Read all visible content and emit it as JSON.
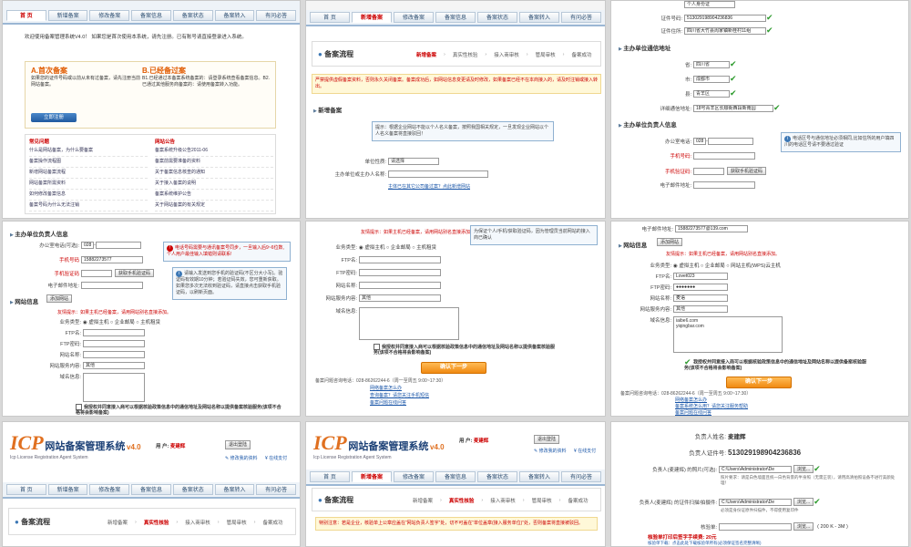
{
  "tabs": [
    "首 页",
    "新增备案",
    "修改备案",
    "备案信息",
    "备案状态",
    "备案转入",
    "有问必答"
  ],
  "p1": {
    "intro": "欢迎使用备案管理系统V4.0！ 如果您是首次使用本系统，请先注册。已有账号请直接登录进入系统。",
    "firstA": "A.首次备案",
    "firstA_text": "如果您的证件号码或以前从未有过备案，请先注册当前网站备案。",
    "firstB": "B.已经备过案",
    "firstB_text": "B1.已经通过本备案系统备案的：请登录系统查看备案信息。B2.已通过其他服务商备案的：请使用备案转入功能。",
    "register_btn": "立即注册",
    "faq_title": "常见问题",
    "notice_title": "网站公告",
    "faq": [
      "什么是网站备案，为什么要备案",
      "备案操作流程图",
      "新增网站备案流程",
      "网站备案所需资料",
      "如何修改备案信息",
      "备案号码为什么无法注销"
    ],
    "notice": [
      "备案系统升级公告2011-06",
      "备案前需要准备的资料",
      "关于备案信息核查的通知",
      "关于接入备案的说明",
      "备案系统维护公告",
      "关于网站备案的有关规定"
    ]
  },
  "p2": {
    "section": "备案流程",
    "flow": [
      "新增备案",
      "真实性核验",
      "接入商审核",
      "管局审核",
      "备案成功"
    ],
    "notice": "严禁提供虚假备案资料，否则永久关闭备案。备案成功后，如网站信息变更请及时修改，如果备案已经不在本商接入的，请及时注销或接入转出。",
    "sub": "新增备案",
    "tip": "提示：根据企业网站不能以个人名义备案，按照我国相关规定，一旦发现企业网站以个人名义备案将直接驳回！",
    "unit_type_label": "单位性质:",
    "unit_type_value": "请选择",
    "host_label": "主办单位或主办人名称:",
    "bottom_link": "主体已在其它公司备过案？点此新增网站"
  },
  "p3": {
    "id_type": "个人身份证",
    "id_no_label": "证件号码:",
    "id_no": "513029198904236836",
    "id_addr_label": "证件住所:",
    "id_addr": "四川省大竹县周家镇新桂村11组",
    "contact_title": "主办单位通信地址",
    "province_label": "省:",
    "province": "四川省",
    "city_label": "市:",
    "city": "成都市",
    "district_label": "县:",
    "district": "青羊区",
    "detail_label": "详细通信地址:",
    "detail": "18号青羊区长顺街西段新南园",
    "person_title": "主办单位负责人信息",
    "tel_label": "办公室电话:",
    "tel_code": "028",
    "mobile_label": "手机号码:",
    "verify_label": "手机验证码:",
    "verify_btn": "获取手机验证码",
    "email_label": "电子邮件地址:",
    "tip": "电话区号与通信地址必须相同,比如住所的用户填四川的电话区号请不要通过验证"
  },
  "p4": {
    "title": "主办单位负责人信息",
    "tel_label": "办公室电话(可选):",
    "tel_code": "028",
    "mobile_label": "手机号码",
    "mobile": "15882273577",
    "verify_label": "手机验证码",
    "verify_btn": "获取手机验证码",
    "email_label": "电子邮件地址:",
    "site_title": "网站信息",
    "add_site": "添加网站",
    "red_tip": "电话号码需要与通讯备案号同步，一旦输入后9~6位数,个人用户最佳输入填错则请联系!",
    "blue_tip": "请输入发送到您手机的验证码(不区分大小写)。验证码有效期10分钟；若验证码失效，您可重新获取。如果您多次无法收到验证码，请直接点击获取手机验证码，以刷新页面。",
    "warning": "友情提示：如果主机已经备案，请用网站别名直接添加。",
    "service_label": "业务类型:",
    "service_opts": [
      "虚拟主机",
      "企业邮局",
      "主机租赁"
    ],
    "ftp_label": "FTP名:",
    "ftp_pw_label": "FTP密码:",
    "site_name_label": "网站名称:",
    "site_type_label": "网站服务内容:",
    "site_type": "其他",
    "domain_label": "域名信息:",
    "agree": "我授权并同意接入商可以根据核验政策信息中的通信地址及网站名称以提供备案核验服务(该项不合格将会影响备案)"
  },
  "p5": {
    "warning": "友情提示：如果主机已经备案，请用网站别名直接添加。",
    "service_label": "业务类型:",
    "service_opts": [
      "虚拟主机",
      "企业邮局",
      "主机租赁"
    ],
    "ftp_label": "FTP名:",
    "ftp_pw_label": "FTP密码:",
    "site_name_label": "网站名称:",
    "site_type_label": "网站服务内容:",
    "site_type": "其他",
    "domain_label": "域名信息:",
    "tip": "为保证个人/手机/获取验证码，因为管理员当前网站的接入商已确认",
    "agree": "我授权并同意接入商可以根据核验政策信息中的通信地址及网站名称以提供备案核验服务(该项不合格将会影响备案)",
    "submit": "确认下一步",
    "hotline": "备案问题咨询电话：028-86262244-6（周一至周五 9:00~17:30）",
    "faq1": "网络备案怎么办",
    "faq2": "查询备案？请您关注手机短信",
    "faq3": "备案问题在线问答"
  },
  "p6": {
    "email_label": "电子邮件地址:",
    "email": "15882273577@139.com",
    "site_title": "网站信息",
    "add_site": "添加网站",
    "warning": "友情提示：如果主机已经备案，请用网站别名直接添加。",
    "service_label": "业务类型:",
    "service_opts": [
      "虚拟主机",
      "企业邮局",
      "网站主机(WPS)云主机"
    ],
    "ftp_label": "FTP名:",
    "ftp": "Lovet023",
    "ftp_pw_label": "FTP密码:",
    "ftp_pw": "●●●●●●●",
    "site_name_label": "网站名称:",
    "site_name": "麦语",
    "site_type_label": "网站服务内容:",
    "site_type": "其他",
    "domain_label": "域名信息:",
    "domains": [
      "iaibe6.com",
      "yiqingbar.com"
    ],
    "agree": "我授权并同意接入商可以根据核验政策信息中的通信地址及网站名称以提供备案核验服务(该项不合格将会影响备案)",
    "submit": "确认下一步",
    "hotline": "备案问题咨询电话：028-86262244-6（周一至周五 9:00~17:30）",
    "faq1": "网络备案怎么办",
    "faq2": "备案系统怎么用？请您关注服务帮助",
    "faq3": "备案问题在线问答"
  },
  "header": {
    "icp": "ICP",
    "title": "网站备案管理系统",
    "version": "v4.0",
    "subtitle": "Icp License Registration Agent System",
    "user_label": "用 户:",
    "user": "麦建辉",
    "logout": "退出登陆",
    "my_info": "修改我的资料",
    "online": "在线支付"
  },
  "p7": {
    "section": "备案流程",
    "flow": [
      "新增备案",
      "真实性核验",
      "接入商审核",
      "管局审核",
      "备案成功"
    ]
  },
  "p8": {
    "section": "备案流程",
    "flow": [
      "新增备案",
      "真实性核验",
      "接入商审核",
      "管局审核",
      "备案成功"
    ],
    "notice": "特别注意：若是企业，核验单上公章应盖在“网站负责人签字”处，切不可盖在“单位盖章(接入服务单位)”处，否则备案将直接被驳回。"
  },
  "p9": {
    "name_label": "负责人姓名:",
    "name": "麦建辉",
    "id_label": "负责人证件号:",
    "id": "513029198904236836",
    "photo_label": "负责人(麦建辉) 的照片(可选):",
    "photo_path": "C:\\Users\\Administrator\\De",
    "photo_note": "照片要求：请是白色墙面且统一白色背景的半身照（无需正装），请用高清拍照设备不进行美颜处理！",
    "scan_label": "负责人(麦建辉) 的证件扫描/拍摄件:",
    "scan_path": "C:\\Users\\Administrator\\De",
    "scan_note": "必须是身份证原件扫描件，不得使用复印件",
    "verify_label": "核验单:",
    "browse": "浏览...",
    "size": "( 200 K - 3M )",
    "bottom": "核验单打印后签字手续费: 20元",
    "bottom2": "核验单下载：点击此处下载核验单所有(必须保证签名完整清晰)"
  }
}
